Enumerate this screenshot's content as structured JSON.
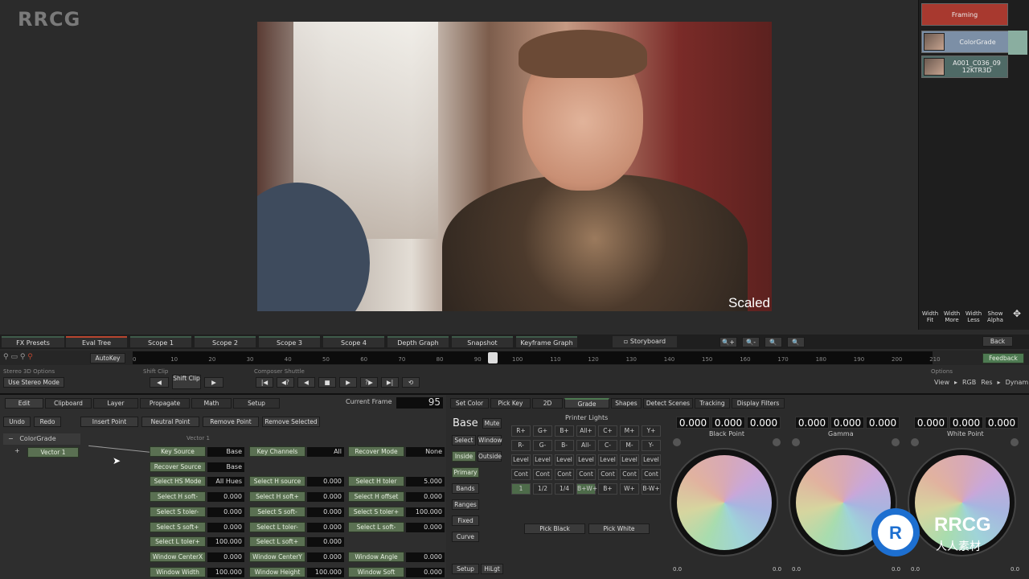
{
  "brand": "RRCG",
  "viewer": {
    "overlay": "Scaled"
  },
  "nodes": {
    "top": "Framing",
    "grade": "ColorGrade",
    "clip": "A001_C036_09 12KTR3D"
  },
  "view_buttons": [
    "Width Fit",
    "Width More",
    "Width Less",
    "Show Alpha"
  ],
  "tabs": [
    "FX Presets",
    "Eval Tree",
    "Scope 1",
    "Scope 2",
    "Scope 3",
    "Scope 4",
    "Depth Graph",
    "Snapshot",
    "Keyframe Graph",
    "Storyboard"
  ],
  "timeline": {
    "autokey": "AutoKey",
    "ticks": [
      "0",
      "10",
      "20",
      "30",
      "40",
      "50",
      "60",
      "70",
      "80",
      "90",
      "100",
      "110",
      "120",
      "130",
      "140",
      "150",
      "160",
      "170",
      "180",
      "190",
      "200",
      "210"
    ],
    "back": "Back",
    "feedback": "Feedback"
  },
  "row3": {
    "stereo_label": "Stereo 3D Options",
    "stereo_btn": "Use Stereo Mode",
    "shift_label": "Shift Clip",
    "shift_btn": "Shift Clip",
    "composer_label": "Composer Shuttle",
    "options_label": "Options",
    "view": "View",
    "rgb": "RGB",
    "res": "Res",
    "dynamic": "Dynamic"
  },
  "edit_tabs": [
    "Edit",
    "Clipboard",
    "Layer",
    "Propagate",
    "Math",
    "Setup"
  ],
  "current_frame_label": "Current Frame",
  "current_frame": "95",
  "edit_buttons": [
    "Undo",
    "Redo",
    "Insert Point",
    "Neutral Point",
    "Remove Point",
    "Remove Selected"
  ],
  "tree": {
    "grade": "ColorGrade",
    "vector": "Vector 1",
    "header": "Vector 1"
  },
  "params": [
    [
      {
        "l": "Key Source",
        "v": "Base"
      },
      {
        "l": "Key Channels",
        "v": "All"
      },
      {
        "l": "Recover Mode",
        "v": "None"
      }
    ],
    [
      {
        "l": "Recover Source",
        "v": "Base"
      },
      {
        "l": "",
        "v": ""
      },
      {
        "l": "",
        "v": ""
      }
    ],
    [
      {
        "l": "Select HS Mode",
        "v": "All Hues"
      },
      {
        "l": "Select H source",
        "v": "0.000"
      },
      {
        "l": "Select H toler",
        "v": "5.000"
      }
    ],
    [
      {
        "l": "Select H soft-",
        "v": "0.000"
      },
      {
        "l": "Select H soft+",
        "v": "0.000"
      },
      {
        "l": "Select H offset",
        "v": "0.000"
      }
    ],
    [
      {
        "l": "Select S toler-",
        "v": "0.000"
      },
      {
        "l": "Select S soft-",
        "v": "0.000"
      },
      {
        "l": "Select S toler+",
        "v": "100.000"
      }
    ],
    [
      {
        "l": "Select S soft+",
        "v": "0.000"
      },
      {
        "l": "Select L toler-",
        "v": "0.000"
      },
      {
        "l": "Select L soft-",
        "v": "0.000"
      }
    ],
    [
      {
        "l": "Select L toler+",
        "v": "100.000"
      },
      {
        "l": "Select L soft+",
        "v": "0.000"
      },
      {
        "l": "",
        "v": ""
      }
    ],
    [
      {
        "l": "Window CenterX",
        "v": "0.000"
      },
      {
        "l": "Window CenterY",
        "v": "0.000"
      },
      {
        "l": "Window Angle",
        "v": "0.000"
      }
    ],
    [
      {
        "l": "Window Width",
        "v": "100.000"
      },
      {
        "l": "Window Height",
        "v": "100.000"
      },
      {
        "l": "Window Soft",
        "v": "0.000"
      }
    ]
  ],
  "grade_tabs": [
    "Set Color",
    "Pick Key",
    "2D",
    "Grade",
    "Shapes",
    "Detect Scenes",
    "Tracking",
    "Display Filters"
  ],
  "grade_side": {
    "base": "Base",
    "mute": "Mute",
    "select": "Select",
    "window": "Window",
    "inside": "Inside",
    "outside": "Outside",
    "items": [
      "Primary",
      "Bands",
      "Ranges",
      "Fixed",
      "Curve"
    ],
    "setup": "Setup",
    "hilgt": "HiLgt"
  },
  "printer_lights": "Printer Lights",
  "printer_grid": [
    [
      "R+",
      "G+",
      "B+",
      "All+",
      "C+",
      "M+",
      "Y+"
    ],
    [
      "R-",
      "G-",
      "B-",
      "All-",
      "C-",
      "M-",
      "Y-"
    ],
    [
      "Level",
      "Level",
      "Level",
      "Level",
      "Level",
      "Level",
      "Level"
    ],
    [
      "Cont",
      "Cont",
      "Cont",
      "Cont",
      "Cont",
      "Cont",
      "Cont"
    ],
    [
      "1",
      "1/2",
      "1/4",
      "B+W+",
      "B+",
      "W+",
      "B-W+"
    ]
  ],
  "pick_black": "Pick Black",
  "pick_white": "Pick White",
  "wheels": [
    {
      "name": "Black Point",
      "vals": [
        "0.000",
        "0.000",
        "0.000"
      ]
    },
    {
      "name": "Gamma",
      "vals": [
        "0.000",
        "0.000",
        "0.000"
      ]
    },
    {
      "name": "White Point",
      "vals": [
        "0.000",
        "0.000",
        "0.000"
      ]
    }
  ],
  "wheel_zero": "0.0",
  "logo": {
    "main": "RRCG",
    "sub": "人人素材"
  }
}
